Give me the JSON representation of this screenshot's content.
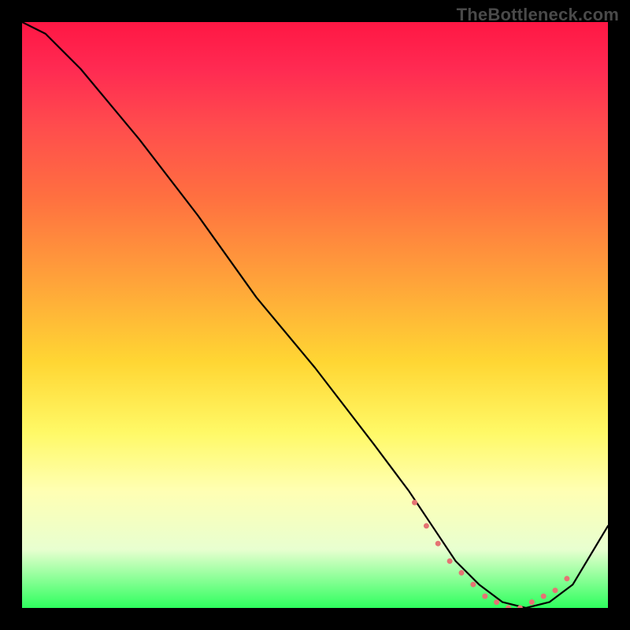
{
  "watermark": "TheBottleneck.com",
  "colors": {
    "background": "#000000",
    "curve": "#000000",
    "markers": "#e57373",
    "gradient_top": "#ff1744",
    "gradient_bottom": "#2eff5e"
  },
  "chart_data": {
    "type": "line",
    "title": "",
    "xlabel": "",
    "ylabel": "",
    "xlim": [
      0,
      100
    ],
    "ylim": [
      0,
      100
    ],
    "grid": false,
    "legend": false,
    "series": [
      {
        "name": "curve",
        "x": [
          0,
          4,
          7,
          10,
          20,
          30,
          40,
          50,
          60,
          66,
          70,
          74,
          78,
          82,
          86,
          90,
          94,
          100
        ],
        "y": [
          100,
          98,
          95,
          92,
          80,
          67,
          53,
          41,
          28,
          20,
          14,
          8,
          4,
          1,
          0,
          1,
          4,
          14
        ]
      }
    ],
    "markers": {
      "name": "dots",
      "x": [
        67,
        69,
        71,
        73,
        75,
        77,
        79,
        81,
        83,
        85,
        87,
        89,
        91,
        93
      ],
      "y": [
        18,
        14,
        11,
        8,
        6,
        4,
        2,
        1,
        0,
        0,
        1,
        2,
        3,
        5
      ],
      "size": 7
    }
  }
}
